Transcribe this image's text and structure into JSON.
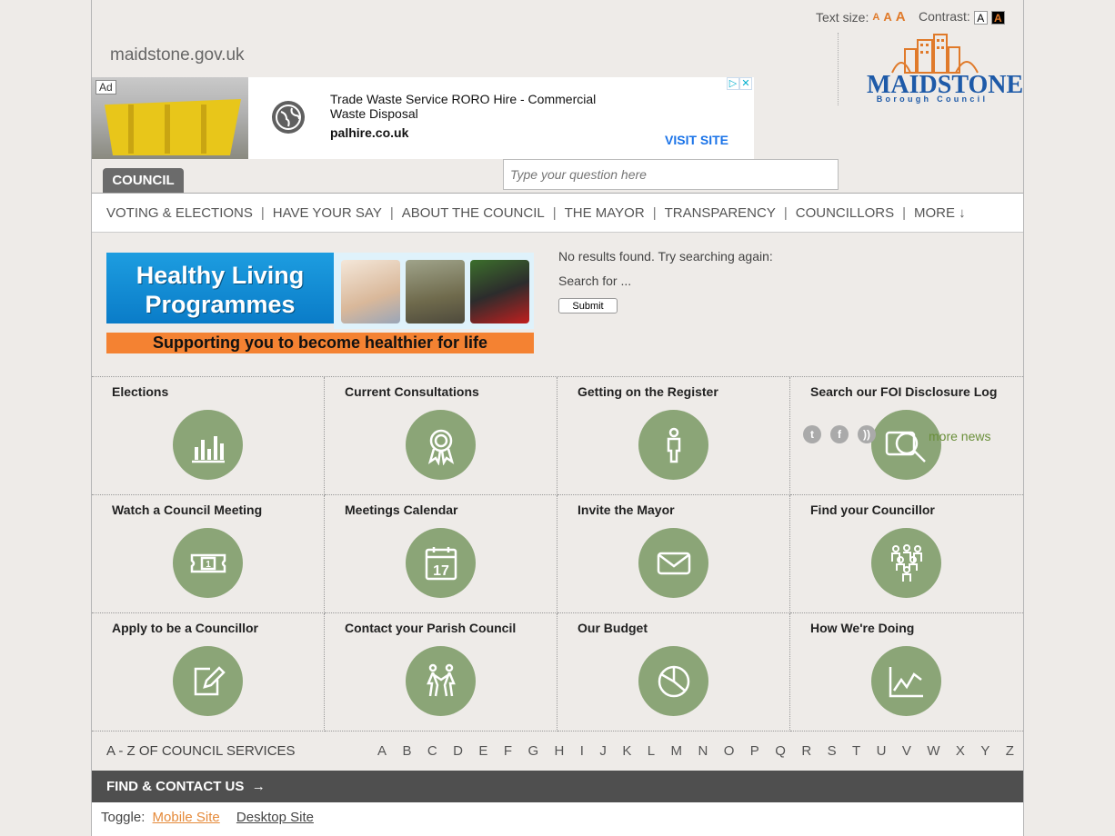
{
  "header": {
    "text_size_label": "Text size:",
    "text_size_options": [
      "A",
      "A",
      "A"
    ],
    "contrast_label": "Contrast:",
    "contrast_options": [
      "A",
      "A"
    ],
    "site_url": "maidstone.gov.uk",
    "logo": {
      "name": "MAIDSTONE",
      "subtitle": "Borough Council"
    }
  },
  "ad": {
    "badge": "Ad",
    "title": "Trade Waste Service RORO Hire - Commercial Waste Disposal",
    "domain": "palhire.co.uk",
    "cta": "VISIT SITE"
  },
  "search": {
    "placeholder": "Type your question here"
  },
  "section_tab": "COUNCIL",
  "nav": {
    "items": [
      "VOTING & ELECTIONS",
      "HAVE YOUR SAY",
      "ABOUT THE COUNCIL",
      "THE MAYOR",
      "TRANSPARENCY",
      "COUNCILLORS",
      "MORE ↓"
    ],
    "separator": "|"
  },
  "banner": {
    "title_line1": "Healthy Living",
    "title_line2": "Programmes",
    "tagline": "Supporting you to become healthier for life"
  },
  "results": {
    "message": "No results found. Try searching again:",
    "search_for": "Search for ...",
    "submit_label": "Submit"
  },
  "tiles": [
    {
      "title": "Elections",
      "icon": "bar-chart-icon"
    },
    {
      "title": "Current Consultations",
      "icon": "award-rosette-icon"
    },
    {
      "title": "Getting on the Register",
      "icon": "person-icon"
    },
    {
      "title": "Search our FOI Disclosure Log",
      "icon": "magnify-document-icon"
    },
    {
      "title": "Watch a Council Meeting",
      "icon": "ticket-icon"
    },
    {
      "title": "Meetings Calendar",
      "icon": "calendar-icon"
    },
    {
      "title": "Invite the Mayor",
      "icon": "envelope-icon"
    },
    {
      "title": "Find your Councillor",
      "icon": "group-icon"
    },
    {
      "title": "Apply to be a Councillor",
      "icon": "edit-icon"
    },
    {
      "title": "Contact your Parish Council",
      "icon": "people-icon"
    },
    {
      "title": "Our Budget",
      "icon": "pie-chart-icon"
    },
    {
      "title": "How We're Doing",
      "icon": "line-chart-icon"
    }
  ],
  "calendar_day": "17",
  "ticket_number": "1",
  "social": {
    "icons": [
      "twitter-icon",
      "facebook-icon",
      "rss-icon"
    ],
    "more_news": "more news"
  },
  "az": {
    "title": "A - Z OF COUNCIL SERVICES",
    "letters": [
      "A",
      "B",
      "C",
      "D",
      "E",
      "F",
      "G",
      "H",
      "I",
      "J",
      "K",
      "L",
      "M",
      "N",
      "O",
      "P",
      "Q",
      "R",
      "S",
      "T",
      "U",
      "V",
      "W",
      "X",
      "Y",
      "Z"
    ]
  },
  "find_contact": "FIND & CONTACT US",
  "toggle": {
    "label": "Toggle:",
    "mobile": "Mobile Site",
    "desktop": "Desktop Site"
  },
  "colors": {
    "tile_icon_bg": "#8ba577",
    "accent_orange": "#e07a2a",
    "logo_blue": "#1e5aa8",
    "more_news_green": "#6a8f3a"
  }
}
